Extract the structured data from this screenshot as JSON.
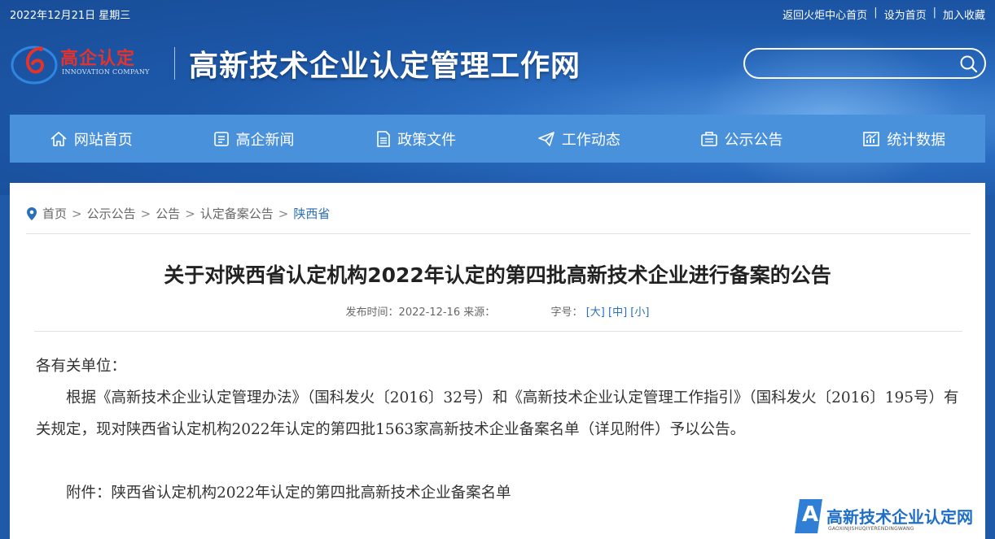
{
  "topbar": {
    "date": "2022年12月21日 星期三",
    "links": [
      "返回火炬中心首页",
      "设为首页",
      "加入收藏"
    ],
    "separator": "|"
  },
  "logo": {
    "cn": "高企认定",
    "en": "INNOVATION COMPANY"
  },
  "site_title": "高新技术企业认定管理工作网",
  "search": {
    "placeholder": "",
    "icon": "search-icon"
  },
  "nav": [
    {
      "label": "网站首页",
      "icon": "home-icon"
    },
    {
      "label": "高企新闻",
      "icon": "news-icon"
    },
    {
      "label": "政策文件",
      "icon": "document-icon"
    },
    {
      "label": "工作动态",
      "icon": "paper-plane-icon"
    },
    {
      "label": "公示公告",
      "icon": "announcement-icon"
    },
    {
      "label": "统计数据",
      "icon": "chart-icon"
    }
  ],
  "breadcrumb": {
    "icon": "location-pin-icon",
    "items": [
      "首页",
      "公示公告",
      "公告",
      "认定备案公告",
      "陕西省"
    ],
    "separator": ">"
  },
  "article": {
    "title": "关于对陕西省认定机构2022年认定的第四批高新技术企业进行备案的公告",
    "meta": {
      "publish_label": "发布时间：",
      "publish_date": "2022-12-16",
      "source_label": "来源：",
      "fontsize_label": "字号：",
      "sizes": [
        "[大]",
        "[中]",
        "[小]"
      ]
    },
    "salutation": "各有关单位：",
    "paragraph": "根据《高新技术企业认定管理办法》（国科发火〔2016〕32号）和《高新技术企业认定管理工作指引》（国科发火〔2016〕195号）有关规定，现对陕西省认定机构2022年认定的第四批1563家高新技术企业备案名单（详见附件）予以公告。",
    "attachment": "附件：陕西省认定机构2022年认定的第四批高新技术企业备案名单"
  },
  "watermark": {
    "letter": "A",
    "cn": "高新技术企业认定网",
    "en": "GAOXINJISHUQIYERENDINGWANG"
  },
  "colors": {
    "header_bg": "#1d58a9",
    "nav_bg": "#4a91dc",
    "link_blue": "#2b6fb8",
    "logo_red": "#e6322a"
  }
}
